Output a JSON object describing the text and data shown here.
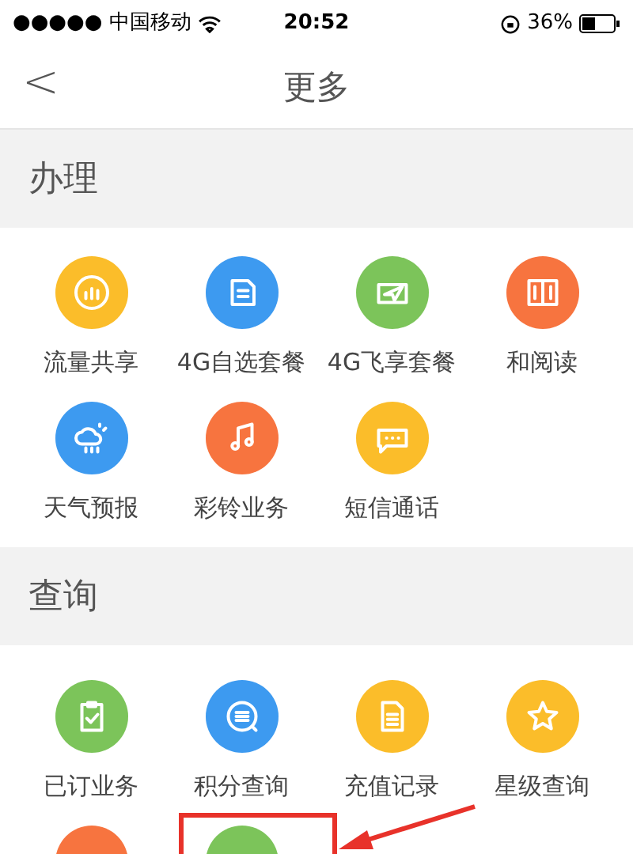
{
  "status_bar": {
    "carrier": "●●●●● 中国移动",
    "time": "20:52",
    "battery": "36%"
  },
  "nav": {
    "back": "<",
    "title": "更多"
  },
  "sections": [
    {
      "title": "办理",
      "items": [
        {
          "label": "流量共享",
          "color": "#fbbd2a",
          "kind": "chart"
        },
        {
          "label": "4G自选套餐",
          "color": "#3d9af0",
          "kind": "sim"
        },
        {
          "label": "4G飞享套餐",
          "color": "#7cc45a",
          "kind": "plane"
        },
        {
          "label": "和阅读",
          "color": "#f7743f",
          "kind": "book"
        },
        {
          "label": "天气预报",
          "color": "#3d9af0",
          "kind": "weather"
        },
        {
          "label": "彩铃业务",
          "color": "#f7743f",
          "kind": "music"
        },
        {
          "label": "短信通话",
          "color": "#fbbd2a",
          "kind": "chat"
        }
      ]
    },
    {
      "title": "查询",
      "items": [
        {
          "label": "已订业务",
          "color": "#7cc45a",
          "kind": "clipboard"
        },
        {
          "label": "积分查询",
          "color": "#3d9af0",
          "kind": "coins"
        },
        {
          "label": "充值记录",
          "color": "#fbbd2a",
          "kind": "document"
        },
        {
          "label": "星级查询",
          "color": "#fbbd2a",
          "kind": "star"
        },
        {
          "color": "#f7743f"
        },
        {
          "color": "#7cc45a",
          "highlighted": true
        }
      ]
    }
  ]
}
